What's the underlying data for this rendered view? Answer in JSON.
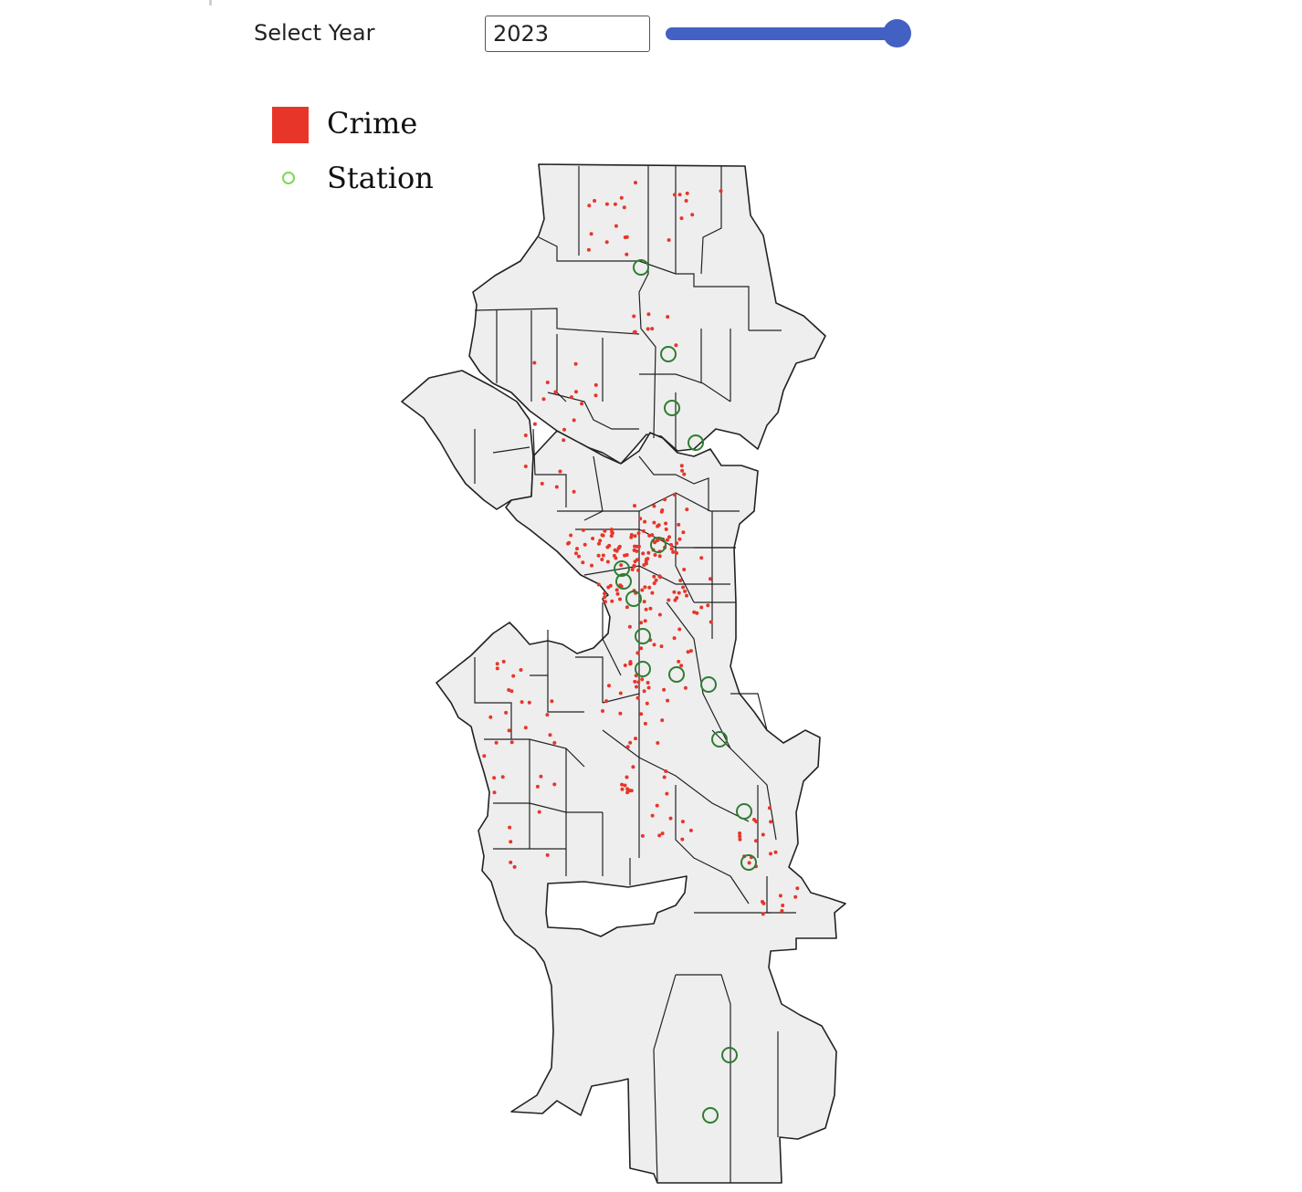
{
  "controls": {
    "year_label": "Select Year",
    "year_value": "2023",
    "slider_value_fraction": 1.0,
    "slider_color": "#4361c2"
  },
  "legend": {
    "items": [
      {
        "label": "Crime",
        "color": "#e8352a",
        "symbol": "square"
      },
      {
        "label": "Station",
        "color": "#7ed957",
        "symbol": "hollow-circle"
      }
    ]
  },
  "map": {
    "land_color": "#eeeeee",
    "boundary_color": "#222222",
    "crime_point_color": "#e8352a",
    "station_marker_color": "#2e7d32"
  }
}
